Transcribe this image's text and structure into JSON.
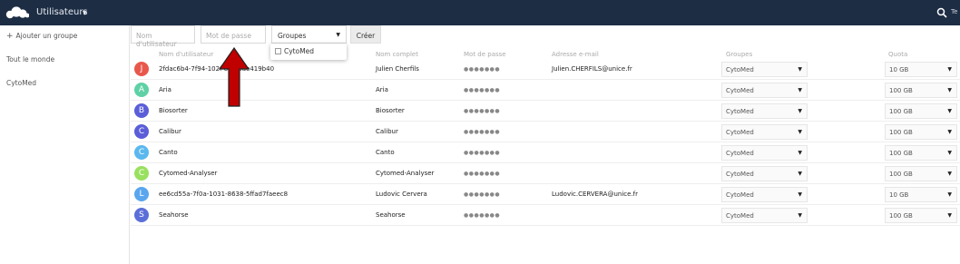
{
  "topbar": {
    "title": "Utilisateurs",
    "right_text": "Te"
  },
  "sidebar": {
    "add_group": "Ajouter un groupe",
    "items": [
      "Tout le monde",
      "CytoMed"
    ]
  },
  "new_user": {
    "username_placeholder": "Nom d'utilisateur",
    "password_placeholder": "Mot de passe",
    "groups_label": "Groupes",
    "create_label": "Créer",
    "dropdown_option": "CytoMed"
  },
  "columns": {
    "username": "Nom d'utilisateur",
    "fullname": "Nom complet",
    "password": "Mot de passe",
    "email": "Adresse e-mail",
    "groups": "Groupes",
    "quota": "Quota"
  },
  "colors": {
    "topbar": "#1d2d44",
    "arrow": "#c00000"
  },
  "users": [
    {
      "initial": "J",
      "color": "#e9574b",
      "username": "2fdac6b4-7f94-102f-86  7bae419b40",
      "fullname": "Julien Cherfils",
      "password": "●●●●●●●",
      "email": "Julien.CHERFILS@unice.fr",
      "group": "CytoMed",
      "quota": "10 GB"
    },
    {
      "initial": "A",
      "color": "#5fd1a6",
      "username": "Aria",
      "fullname": "Aria",
      "password": "●●●●●●●",
      "email": "",
      "group": "CytoMed",
      "quota": "100 GB"
    },
    {
      "initial": "B",
      "color": "#5b5ed8",
      "username": "Biosorter",
      "fullname": "Biosorter",
      "password": "●●●●●●●",
      "email": "",
      "group": "CytoMed",
      "quota": "100 GB"
    },
    {
      "initial": "C",
      "color": "#5b5ed8",
      "username": "Calibur",
      "fullname": "Calibur",
      "password": "●●●●●●●",
      "email": "",
      "group": "CytoMed",
      "quota": "100 GB"
    },
    {
      "initial": "C",
      "color": "#5ab8ee",
      "username": "Canto",
      "fullname": "Canto",
      "password": "●●●●●●●",
      "email": "",
      "group": "CytoMed",
      "quota": "100 GB"
    },
    {
      "initial": "C",
      "color": "#99e05f",
      "username": "Cytomed-Analyser",
      "fullname": "Cytomed-Analyser",
      "password": "●●●●●●●",
      "email": "",
      "group": "CytoMed",
      "quota": "100 GB"
    },
    {
      "initial": "L",
      "color": "#5aa6ee",
      "username": "ee6cd55a-7f0a-1031-8638-5ffad7faeec8",
      "fullname": "Ludovic Cervera",
      "password": "●●●●●●●",
      "email": "Ludovic.CERVERA@unice.fr",
      "group": "CytoMed",
      "quota": "10 GB"
    },
    {
      "initial": "S",
      "color": "#5b6fd8",
      "username": "Seahorse",
      "fullname": "Seahorse",
      "password": "●●●●●●●",
      "email": "",
      "group": "CytoMed",
      "quota": "100 GB"
    }
  ]
}
